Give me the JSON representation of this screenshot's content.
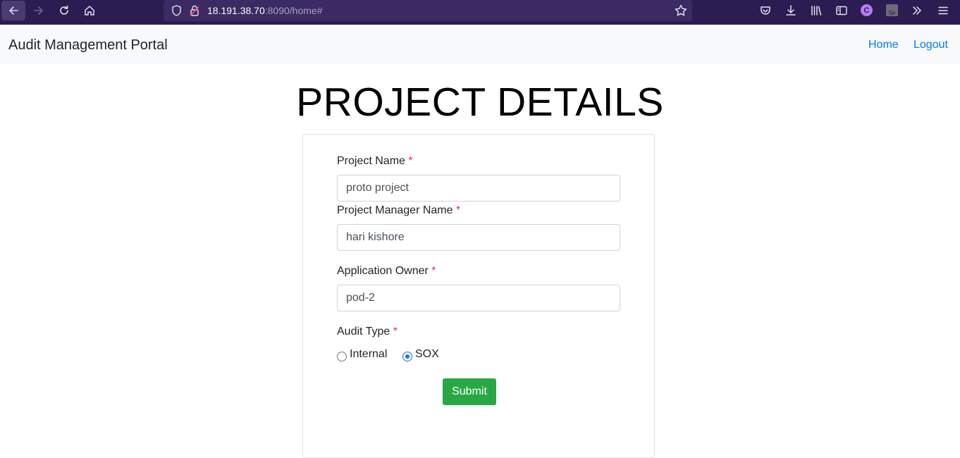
{
  "browser": {
    "url_host": "18.191.38.70",
    "url_rest": ":8090/home#",
    "account_initial": "C",
    "extension_label": "Se"
  },
  "navbar": {
    "brand": "Audit Management Portal",
    "links": [
      "Home",
      "Logout"
    ]
  },
  "page": {
    "title": "PROJECT DETAILS"
  },
  "form": {
    "required_mark": "*",
    "project_name": {
      "label": "Project Name",
      "value": "proto project"
    },
    "manager_name": {
      "label": "Project Manager Name",
      "value": "hari kishore"
    },
    "app_owner": {
      "label": "Application Owner",
      "value": "pod-2"
    },
    "audit_type": {
      "label": "Audit Type",
      "options": [
        "Internal",
        "SOX"
      ],
      "selected": "SOX"
    },
    "submit_label": "Submit"
  },
  "colors": {
    "browser_bg": "#2b1c52",
    "link": "#007bff",
    "submit": "#28a745",
    "required": "#dc3545",
    "radio_selected": "#1a73e8"
  },
  "icons": {
    "back": "arrow-left-icon",
    "forward": "arrow-right-icon",
    "reload": "reload-icon",
    "home": "home-icon",
    "shield": "shield-icon",
    "lock": "lock-icon",
    "star": "star-icon",
    "pocket": "pocket-icon",
    "download": "download-icon",
    "library": "library-icon",
    "sidebar": "sidebar-icon",
    "overflow": "chevron-double-right-icon",
    "menu": "hamburger-menu-icon"
  }
}
